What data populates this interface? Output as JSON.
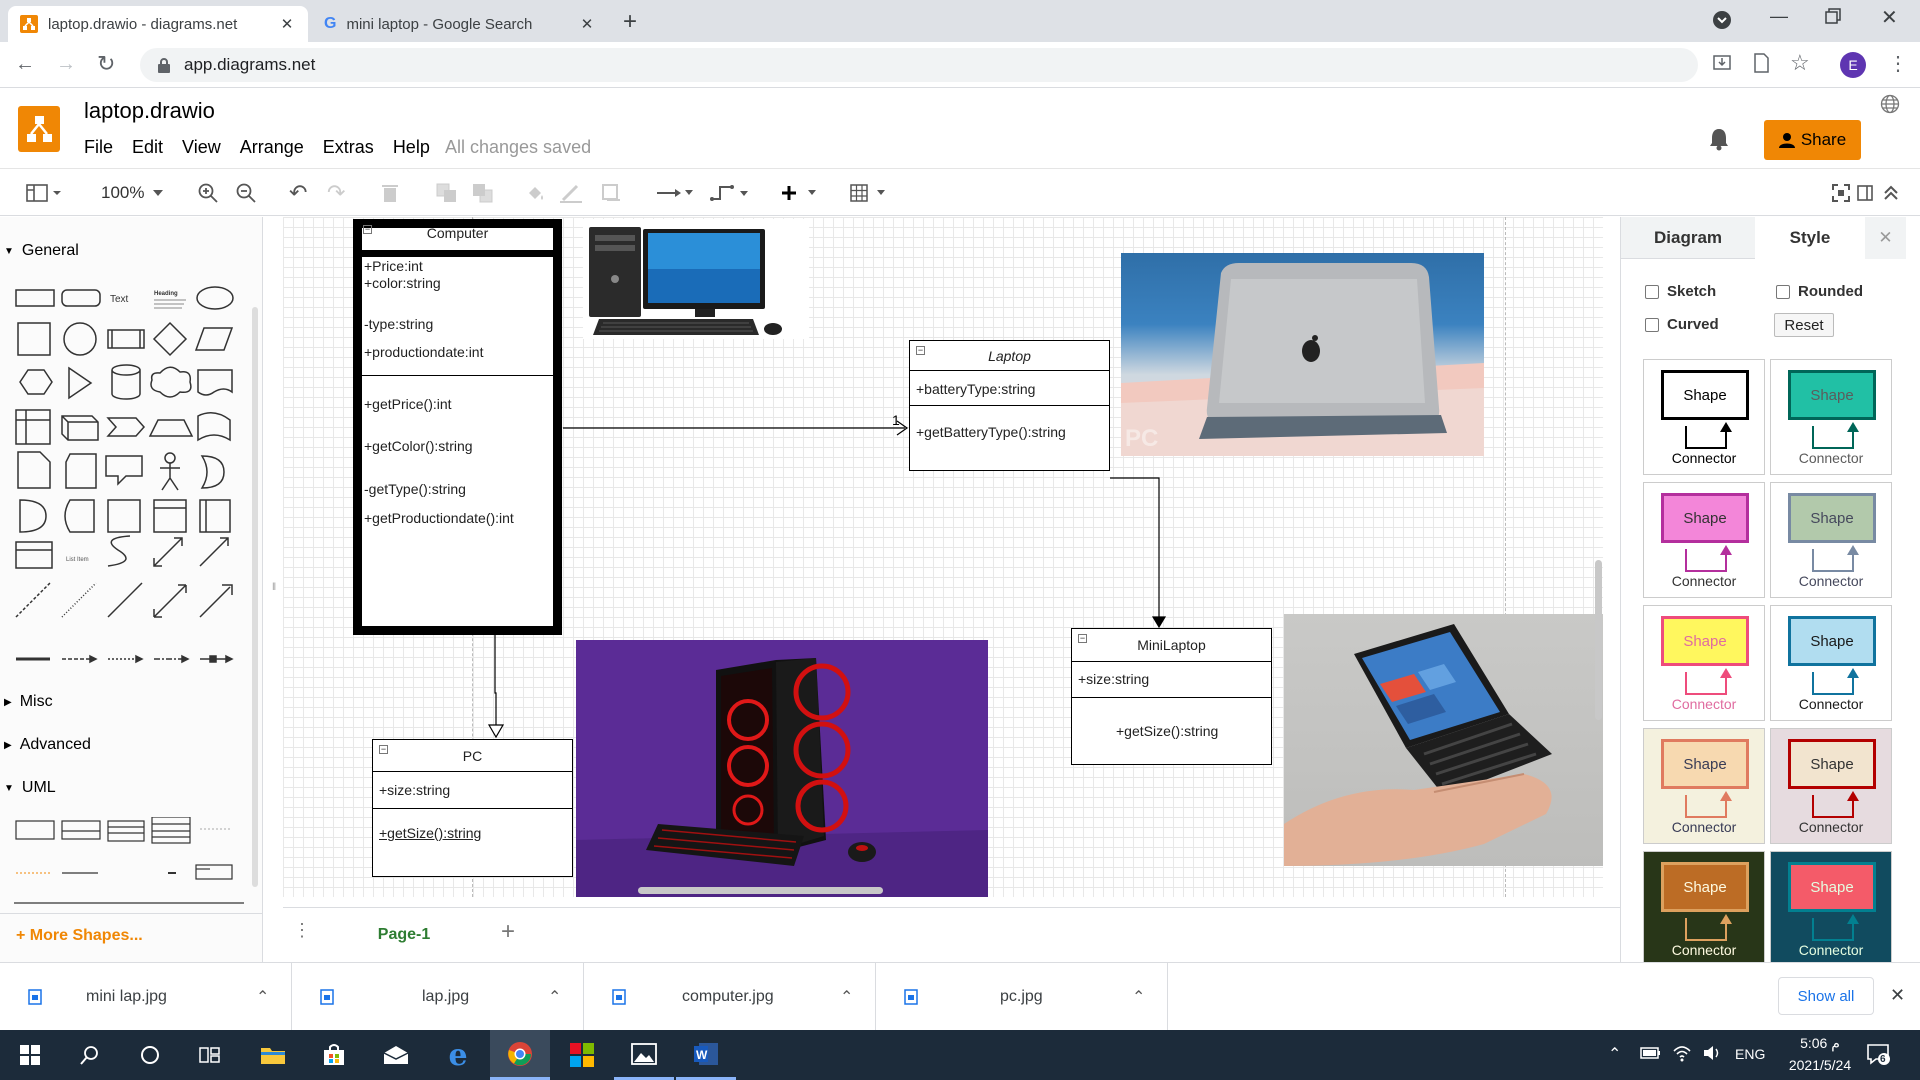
{
  "browser": {
    "tabs": [
      {
        "title": "laptop.drawio - diagrams.net",
        "icon": "drawio-favicon",
        "active": true
      },
      {
        "title": "mini laptop - Google Search",
        "icon": "google-favicon",
        "active": false
      }
    ],
    "url": "app.diagrams.net",
    "profile_initial": "E"
  },
  "app": {
    "doc_title": "laptop.drawio",
    "menus": [
      "File",
      "Edit",
      "View",
      "Arrange",
      "Extras",
      "Help"
    ],
    "save_status": "All changes saved",
    "share_label": "Share",
    "zoom": "100%"
  },
  "sidebar": {
    "sections": [
      "General",
      "Misc",
      "Advanced",
      "UML"
    ],
    "general_text_shape": "Text",
    "general_heading_shape": "Heading",
    "list_item_label": "List Item",
    "more_shapes": "+ More Shapes..."
  },
  "diagram": {
    "computer": {
      "name": "Computer",
      "attributes": [
        "+Price:int",
        "+color:string",
        "-type:string",
        "+productiondate:int"
      ],
      "methods": [
        "+getPrice():int",
        "+getColor():string",
        "-getType():string",
        "+getProductiondate():int"
      ]
    },
    "laptop": {
      "name": "Laptop",
      "attributes": [
        "+batteryType:string"
      ],
      "methods": [
        "+getBatteryType():string"
      ]
    },
    "pc": {
      "name": "PC",
      "attributes": [
        "+size:string"
      ],
      "methods": [
        "+getSize():string"
      ]
    },
    "minilaptop": {
      "name": "MiniLaptop",
      "attributes": [
        "+size:string"
      ],
      "methods": [
        "+getSize():string"
      ]
    },
    "multiplicity": "1",
    "photo_watermark": "PC"
  },
  "pages": {
    "current": "Page-1"
  },
  "format_panel": {
    "tabs": [
      "Diagram",
      "Style"
    ],
    "options": {
      "sketch": "Sketch",
      "rounded": "Rounded",
      "curved": "Curved",
      "reset": "Reset"
    },
    "styles": [
      {
        "shape": "Shape",
        "connector": "Connector",
        "fill": "#ffffff",
        "stroke": "#000000",
        "text": "#000000",
        "bg": "#ffffff",
        "ctext": "#000000"
      },
      {
        "shape": "Shape",
        "connector": "Connector",
        "fill": "#21c0a5",
        "stroke": "#006658",
        "text": "#5c5c5c",
        "bg": "#ffffff",
        "ctext": "#5c5c5c"
      },
      {
        "shape": "Shape",
        "connector": "Connector",
        "fill": "#f386d9",
        "stroke": "#b42f9d",
        "text": "#333333",
        "bg": "#ffffff",
        "ctext": "#333333"
      },
      {
        "shape": "Shape",
        "connector": "Connector",
        "fill": "#b2c9ab",
        "stroke": "#788aa3",
        "text": "#46495d",
        "bg": "#ffffff",
        "ctext": "#46495d"
      },
      {
        "shape": "Shape",
        "connector": "Connector",
        "fill": "#fff75e",
        "stroke": "#ee4c7c",
        "text": "#e06ca0",
        "bg": "#ffffff",
        "ctext": "#e06ca0"
      },
      {
        "shape": "Shape",
        "connector": "Connector",
        "fill": "#b1ddf0",
        "stroke": "#10739e",
        "text": "#1a1a1a",
        "bg": "#ffffff",
        "ctext": "#1a1a1a"
      },
      {
        "shape": "Shape",
        "connector": "Connector",
        "fill": "#f7d9b0",
        "stroke": "#e07a5f",
        "text": "#393c56",
        "bg": "#f4f1de",
        "ctext": "#393c56"
      },
      {
        "shape": "Shape",
        "connector": "Connector",
        "fill": "#f2e4cf",
        "stroke": "#b30000",
        "text": "#333333",
        "bg": "#e6dbdf",
        "ctext": "#333333"
      },
      {
        "shape": "Shape",
        "connector": "Connector",
        "fill": "#bc6c25",
        "stroke": "#dda15e",
        "text": "#fefae0",
        "bg": "#283618",
        "ctext": "#fefae0"
      },
      {
        "shape": "Shape",
        "connector": "Connector",
        "fill": "#f45b69",
        "stroke": "#028090",
        "text": "#e4fde1",
        "bg": "#114b5f",
        "ctext": "#e4fde1"
      }
    ]
  },
  "downloads": {
    "items": [
      "mini lap.jpg",
      "lap.jpg",
      "computer.jpg",
      "pc.jpg"
    ],
    "show_all": "Show all"
  },
  "taskbar": {
    "lang": "ENG",
    "time": "م 5:06",
    "date": "2021/5/24",
    "notifications": "6"
  }
}
